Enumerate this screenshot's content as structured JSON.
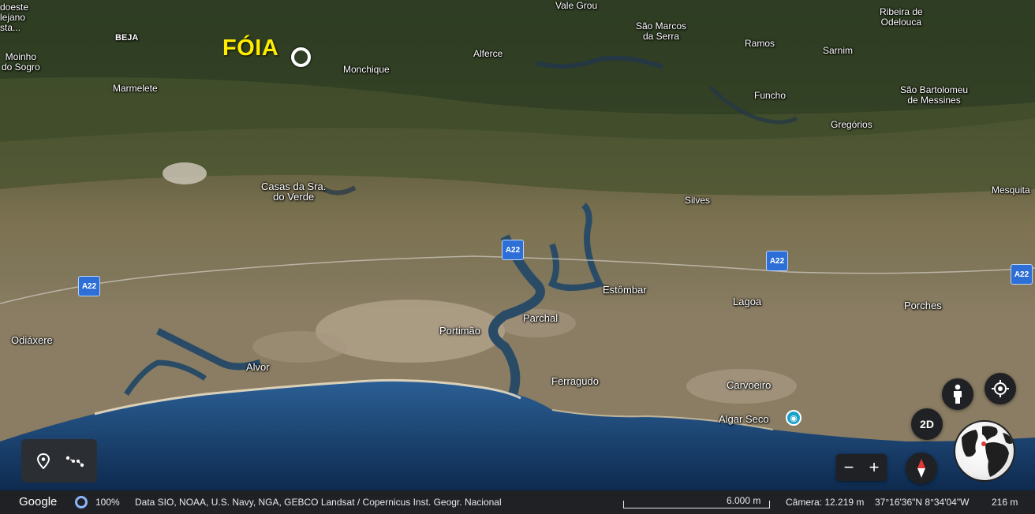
{
  "map": {
    "highlight_label": "FÓIA",
    "places": [
      {
        "id": "oeste",
        "text": "doeste\nlejano\nsta..."
      },
      {
        "id": "beja",
        "text": "BEJA"
      },
      {
        "id": "moinho",
        "text": "Moinho\ndo Sogro"
      },
      {
        "id": "marmelete",
        "text": "Marmelete"
      },
      {
        "id": "monchique",
        "text": "Monchique"
      },
      {
        "id": "alferce",
        "text": "Alferce"
      },
      {
        "id": "vale-grou",
        "text": "Vale Grou"
      },
      {
        "id": "sao-marcos",
        "text": "São Marcos\nda Serra"
      },
      {
        "id": "ribeira",
        "text": "Ribeira de\nOdelouca"
      },
      {
        "id": "ramos",
        "text": "Ramos"
      },
      {
        "id": "sarnim",
        "text": "Sarnim"
      },
      {
        "id": "sao-bartolomeu",
        "text": "São Bartolomeu\nde Messines"
      },
      {
        "id": "funcho",
        "text": "Funcho"
      },
      {
        "id": "gregorios",
        "text": "Gregórios"
      },
      {
        "id": "casas",
        "text": "Casas da Sra.\ndo Verde"
      },
      {
        "id": "silves",
        "text": "Silves"
      },
      {
        "id": "mesquita",
        "text": "Mesquita"
      },
      {
        "id": "estombar",
        "text": "Estômbar"
      },
      {
        "id": "lagoa",
        "text": "Lagoa"
      },
      {
        "id": "porches",
        "text": "Porches"
      },
      {
        "id": "odiaxere",
        "text": "Odiáxere"
      },
      {
        "id": "portimao",
        "text": "Portimão"
      },
      {
        "id": "parchal",
        "text": "Parchal"
      },
      {
        "id": "alvor",
        "text": "Alvor"
      },
      {
        "id": "ferragudo",
        "text": "Ferragudo"
      },
      {
        "id": "carvoeiro",
        "text": "Carvoeiro"
      },
      {
        "id": "algar-seco",
        "text": "Algar Seco"
      }
    ],
    "road_label": "A22"
  },
  "controls": {
    "view_mode": "2D",
    "zoom_out": "−",
    "zoom_in": "+"
  },
  "status": {
    "brand": "Google",
    "progress": "100%",
    "attribution": "Data SIO, NOAA, U.S. Navy, NGA, GEBCO  Landsat / Copernicus  Inst. Geogr. Nacional",
    "scale": "6.000 m",
    "camera": "Câmera: 12.219 m",
    "coordinates": "37°16'36\"N 8°34'04\"W",
    "elevation": "216 m"
  }
}
